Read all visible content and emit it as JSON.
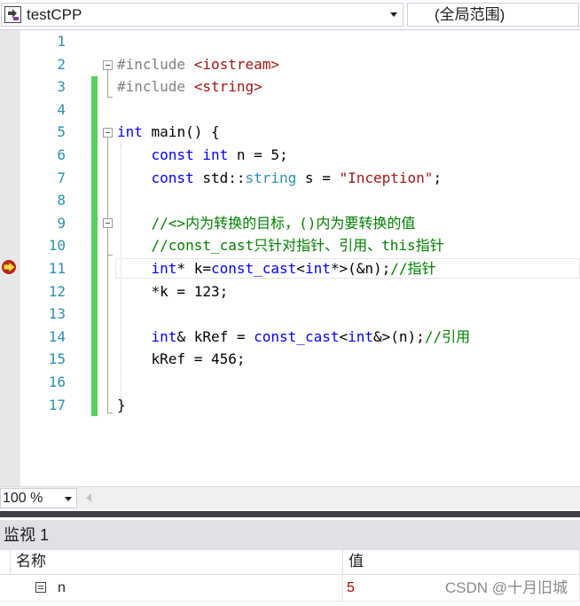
{
  "navbar": {
    "project": "testCPP",
    "scope": "(全局范围)"
  },
  "editor": {
    "lines": [
      {
        "n": "1",
        "segs": []
      },
      {
        "n": "2",
        "segs": [
          {
            "t": "#include ",
            "c": "pp"
          },
          {
            "t": "<iostream>",
            "c": "str"
          }
        ]
      },
      {
        "n": "3",
        "segs": [
          {
            "t": "#include ",
            "c": "pp"
          },
          {
            "t": "<string>",
            "c": "str"
          }
        ]
      },
      {
        "n": "4",
        "segs": []
      },
      {
        "n": "5",
        "segs": [
          {
            "t": "int",
            "c": "kw"
          },
          {
            "t": " main() {",
            "c": ""
          }
        ]
      },
      {
        "n": "6",
        "segs": [
          {
            "t": "    ",
            "c": ""
          },
          {
            "t": "const",
            "c": "kw"
          },
          {
            "t": " ",
            "c": ""
          },
          {
            "t": "int",
            "c": "kw"
          },
          {
            "t": " n = 5;",
            "c": ""
          }
        ]
      },
      {
        "n": "7",
        "segs": [
          {
            "t": "    ",
            "c": ""
          },
          {
            "t": "const",
            "c": "kw"
          },
          {
            "t": " std::",
            "c": ""
          },
          {
            "t": "string",
            "c": "ty"
          },
          {
            "t": " s = ",
            "c": ""
          },
          {
            "t": "\"Inception\"",
            "c": "str"
          },
          {
            "t": ";",
            "c": ""
          }
        ]
      },
      {
        "n": "8",
        "segs": []
      },
      {
        "n": "9",
        "segs": [
          {
            "t": "    //<>内为转换的目标，()内为要转换的值",
            "c": "cm"
          }
        ]
      },
      {
        "n": "10",
        "segs": [
          {
            "t": "    //const_cast只针对指针、引用、this指针",
            "c": "cm"
          }
        ]
      },
      {
        "n": "11",
        "segs": [
          {
            "t": "    ",
            "c": ""
          },
          {
            "t": "int",
            "c": "kw"
          },
          {
            "t": "* k=",
            "c": ""
          },
          {
            "t": "const_cast",
            "c": "kw"
          },
          {
            "t": "<",
            "c": ""
          },
          {
            "t": "int",
            "c": "kw"
          },
          {
            "t": "*>(&n);",
            "c": ""
          },
          {
            "t": "//指针",
            "c": "cm"
          }
        ]
      },
      {
        "n": "12",
        "segs": [
          {
            "t": "    *k = 123;",
            "c": ""
          }
        ]
      },
      {
        "n": "13",
        "segs": []
      },
      {
        "n": "14",
        "segs": [
          {
            "t": "    ",
            "c": ""
          },
          {
            "t": "int",
            "c": "kw"
          },
          {
            "t": "& kRef = ",
            "c": ""
          },
          {
            "t": "const_cast",
            "c": "kw"
          },
          {
            "t": "<",
            "c": ""
          },
          {
            "t": "int",
            "c": "kw"
          },
          {
            "t": "&>(n);",
            "c": ""
          },
          {
            "t": "//引用",
            "c": "cm"
          }
        ]
      },
      {
        "n": "15",
        "segs": [
          {
            "t": "    kRef = 456;",
            "c": ""
          }
        ]
      },
      {
        "n": "16",
        "segs": []
      },
      {
        "n": "17",
        "segs": [
          {
            "t": "}",
            "c": ""
          }
        ]
      }
    ]
  },
  "zoom": {
    "value": "100 %"
  },
  "watch": {
    "title": "监视 1",
    "col_name": "名称",
    "col_value": "值",
    "rows": [
      {
        "name": "n",
        "value": "5"
      }
    ],
    "watermark": "CSDN @十月旧城"
  }
}
